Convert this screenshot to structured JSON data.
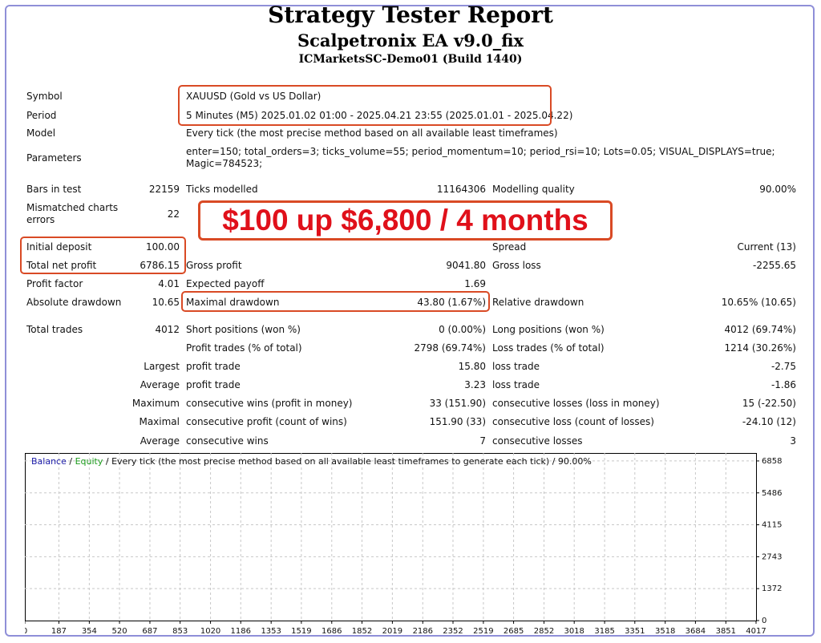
{
  "header": {
    "title": "Strategy Tester Report",
    "ea_name": "Scalpetronix EA v9.0_fix",
    "server": "ICMarketsSC-Demo01 (Build 1440)"
  },
  "settings": {
    "symbol_label": "Symbol",
    "symbol_value": "XAUUSD (Gold vs US Dollar)",
    "period_label": "Period",
    "period_value": "5 Minutes (M5) 2025.01.02 01:00 - 2025.04.21 23:55 (2025.01.01 - 2025.04.22)",
    "model_label": "Model",
    "model_value": "Every tick (the most precise method based on all available least timeframes)",
    "parameters_label": "Parameters",
    "parameters_line1": "enter=150; total_orders=3; ticks_volume=55; period_momentum=10; period_rsi=10; Lots=0.05; VISUAL_DISPLAYS=true;",
    "parameters_line2": "Magic=784523;"
  },
  "stats": {
    "bars_label": "Bars in test",
    "bars_value": "22159",
    "ticks_label": "Ticks modelled",
    "ticks_value": "11164306",
    "quality_label": "Modelling quality",
    "quality_value": "90.00%",
    "mismatch_label_1": "Mismatched charts",
    "mismatch_label_2": "errors",
    "mismatch_value": "22",
    "initial_deposit_label": "Initial deposit",
    "initial_deposit_value": "100.00",
    "spread_label": "Spread",
    "spread_value": "Current (13)",
    "net_profit_label": "Total net profit",
    "net_profit_value": "6786.15",
    "gross_profit_label": "Gross profit",
    "gross_profit_value": "9041.80",
    "gross_loss_label": "Gross loss",
    "gross_loss_value": "-2255.65",
    "profit_factor_label": "Profit factor",
    "profit_factor_value": "4.01",
    "expected_payoff_label": "Expected payoff",
    "expected_payoff_value": "1.69",
    "abs_drawdown_label": "Absolute drawdown",
    "abs_drawdown_value": "10.65",
    "max_drawdown_label": "Maximal drawdown",
    "max_drawdown_value": "43.80 (1.67%)",
    "rel_drawdown_label": "Relative drawdown",
    "rel_drawdown_value": "10.65% (10.65)",
    "total_trades_label": "Total trades",
    "total_trades_value": "4012",
    "short_label": "Short positions (won %)",
    "short_value": "0 (0.00%)",
    "long_label": "Long positions (won %)",
    "long_value": "4012 (69.74%)",
    "profit_trades_label": "Profit trades (% of total)",
    "profit_trades_value": "2798 (69.74%)",
    "loss_trades_label": "Loss trades (% of total)",
    "loss_trades_value": "1214 (30.26%)",
    "largest_label": "Largest",
    "largest_profit_label": "profit trade",
    "largest_profit_value": "15.80",
    "largest_loss_label": "loss trade",
    "largest_loss_value": "-2.75",
    "average_label": "Average",
    "average_profit_label": "profit trade",
    "average_profit_value": "3.23",
    "average_loss_label": "loss trade",
    "average_loss_value": "-1.86",
    "maximum_label": "Maximum",
    "max_cons_wins_label": "consecutive wins (profit in money)",
    "max_cons_wins_value": "33 (151.90)",
    "max_cons_losses_label": "consecutive losses (loss in money)",
    "max_cons_losses_value": "15 (-22.50)",
    "maximal_label": "Maximal",
    "maximal_cons_profit_label": "consecutive profit (count of wins)",
    "maximal_cons_profit_value": "151.90 (33)",
    "maximal_cons_loss_label": "consecutive loss (count of losses)",
    "maximal_cons_loss_value": "-24.10 (12)",
    "avg_label": "Average",
    "avg_cons_wins_label": "consecutive wins",
    "avg_cons_wins_value": "7",
    "avg_cons_losses_label": "consecutive losses",
    "avg_cons_losses_value": "3"
  },
  "banner": {
    "text": "$100 up $6,800 / 4 months"
  },
  "colors": {
    "highlight": "#d94a25",
    "banner_text": "#e0101a",
    "balance": "#1a1aa8",
    "equity": "#1a9a1a",
    "frame": "#8f8fd8"
  },
  "chart_data": {
    "type": "line",
    "legend": {
      "balance": "Balance",
      "sep1": " / ",
      "equity": "Equity",
      "sep2": " / ",
      "rest": "Every tick (the most precise method based on all available least timeframes to generate each tick) / 90.00%"
    },
    "x_ticks": [
      0,
      187,
      354,
      520,
      687,
      853,
      1020,
      1186,
      1353,
      1519,
      1686,
      1852,
      2019,
      2186,
      2352,
      2519,
      2685,
      2852,
      3018,
      3185,
      3351,
      3518,
      3684,
      3851,
      4017
    ],
    "y_ticks": [
      0,
      1372,
      2743,
      4115,
      5486,
      6858
    ],
    "xlim": [
      0,
      4017
    ],
    "ylim": [
      0,
      7200
    ],
    "grid": true,
    "series": []
  }
}
